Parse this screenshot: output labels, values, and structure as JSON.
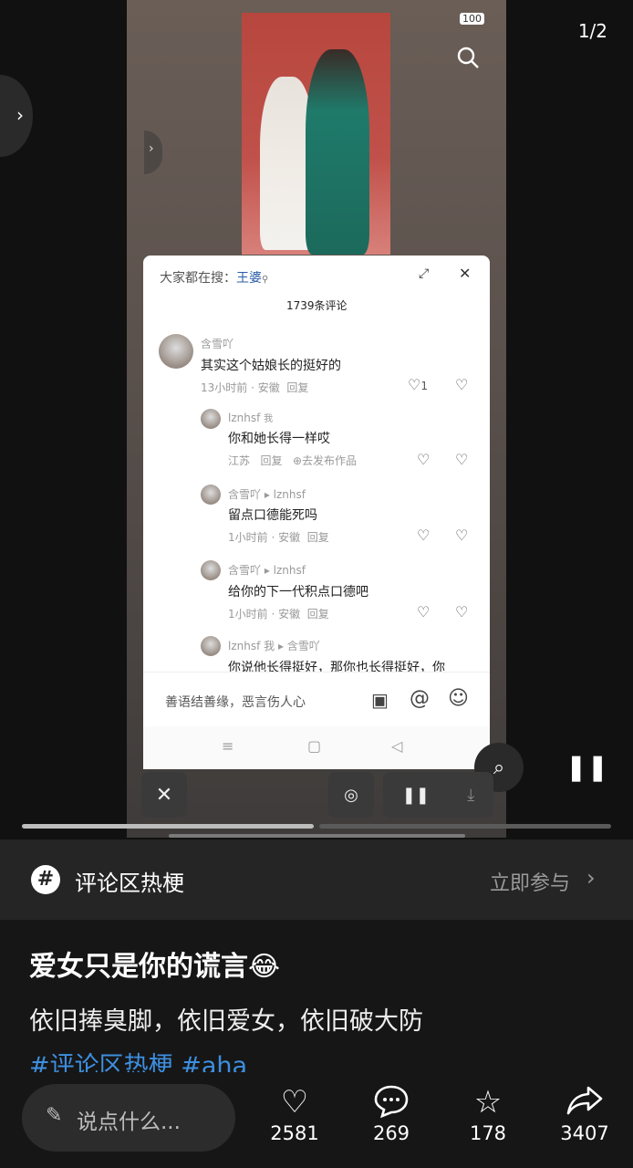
{
  "status_bar": {
    "time": "",
    "battery": "100"
  },
  "page_counter": "1/2",
  "comment_panel": {
    "search_prefix": "大家都在搜：",
    "search_term": "王婆",
    "count_label": "1739条评论",
    "comments": [
      {
        "user": "含雪吖",
        "text": "其实这个姑娘长的挺好的",
        "meta": "13小时前 · 安徽",
        "reply": "回复",
        "likes": "1"
      },
      {
        "user": "lznhsf",
        "tag": "我",
        "text": "你和她长得一样哎",
        "meta": "江苏",
        "reply": "回复",
        "extra": "去发布作品"
      },
      {
        "user": "含雪吖 ▸ lznhsf",
        "text": "留点口德能死吗",
        "meta": "1小时前 · 安徽",
        "reply": "回复"
      },
      {
        "user": "含雪吖 ▸ lznhsf",
        "text": "给你的下一代积点口德吧",
        "meta": "1小时前 · 安徽",
        "reply": "回复"
      },
      {
        "user": "lznhsf 我 ▸ 含雪吖",
        "text": "你说他长得挺好，那你也长得挺好，你"
      }
    ],
    "input_placeholder": "善语结善缘，恶言伤人心"
  },
  "topic_bar": {
    "label": "评论区热梗",
    "join": "立即参与"
  },
  "post": {
    "title": "爱女只是你的谎言😂",
    "body": "依旧捧臭脚，依旧爱女，依旧破大防",
    "tags": "#评论区热梗 #aha"
  },
  "bottom_bar": {
    "comment_placeholder": "说点什么...",
    "likes": "2581",
    "comments": "269",
    "favorites": "178",
    "shares": "3407"
  }
}
